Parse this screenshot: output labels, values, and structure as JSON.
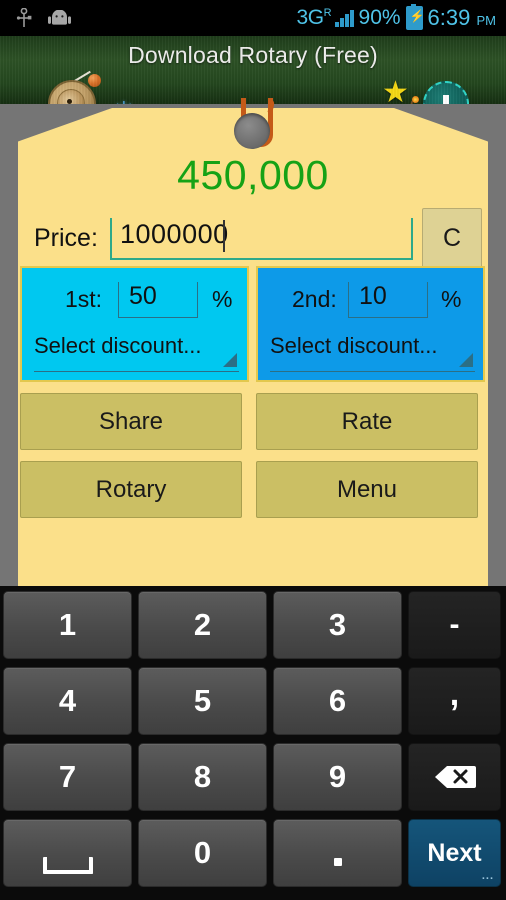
{
  "statusbar": {
    "usb_icon": "usb-icon",
    "robot_icon": "android-robot-icon",
    "network": "3G",
    "network_sup": "R",
    "signal_icon": "signal-bars-icon",
    "battery_percent": "90%",
    "battery_icon": "battery-charging-icon",
    "time": "6:39",
    "ampm": "PM"
  },
  "ad": {
    "title": "Download Rotary (Free)",
    "rotary_icon": "rotary-disc-icon",
    "snowflake_icon": "snowflake-icon",
    "star_icon": "star-icon",
    "bomb_icon": "bomb-icon",
    "download_icon": "download-arrow-icon",
    "bars": [
      "red",
      "yellow",
      "green",
      "white"
    ]
  },
  "tag": {
    "result": "450,000",
    "price_label": "Price:",
    "price_value": "1000000",
    "price_placeholder": "",
    "clear_label": "C",
    "discounts": [
      {
        "ordinal": "1st:",
        "value": "50",
        "percent": "%",
        "select_label": "Select discount...",
        "color": "#00c8f0"
      },
      {
        "ordinal": "2nd:",
        "value": "10",
        "percent": "%",
        "select_label": "Select discount...",
        "color": "#0d9ae8"
      }
    ],
    "actions": [
      {
        "label": "Share"
      },
      {
        "label": "Rate"
      },
      {
        "label": "Rotary"
      },
      {
        "label": "Menu"
      }
    ]
  },
  "keyboard": {
    "rows": [
      [
        {
          "label": "1",
          "type": "num"
        },
        {
          "label": "2",
          "type": "num"
        },
        {
          "label": "3",
          "type": "num"
        },
        {
          "label": "-",
          "type": "fn"
        }
      ],
      [
        {
          "label": "4",
          "type": "num"
        },
        {
          "label": "5",
          "type": "num"
        },
        {
          "label": "6",
          "type": "num"
        },
        {
          "label": ",",
          "type": "fn"
        }
      ],
      [
        {
          "label": "7",
          "type": "num"
        },
        {
          "label": "8",
          "type": "num"
        },
        {
          "label": "9",
          "type": "num"
        },
        {
          "label": "backspace-icon",
          "type": "fn"
        }
      ],
      [
        {
          "label": "space-icon",
          "type": "num"
        },
        {
          "label": "0",
          "type": "num"
        },
        {
          "label": ".",
          "type": "num"
        },
        {
          "label": "Next",
          "type": "next"
        }
      ]
    ],
    "next_dots": "..."
  },
  "colors": {
    "tag_bg": "#fbe08a",
    "result_green": "#16a216",
    "action_btn": "#cbbf64",
    "clear_btn": "#ded294",
    "accent_blue_1": "#00c8f0",
    "accent_blue_2": "#0d9ae8",
    "next_key": "#0e4264",
    "page_bg": "#757575"
  }
}
